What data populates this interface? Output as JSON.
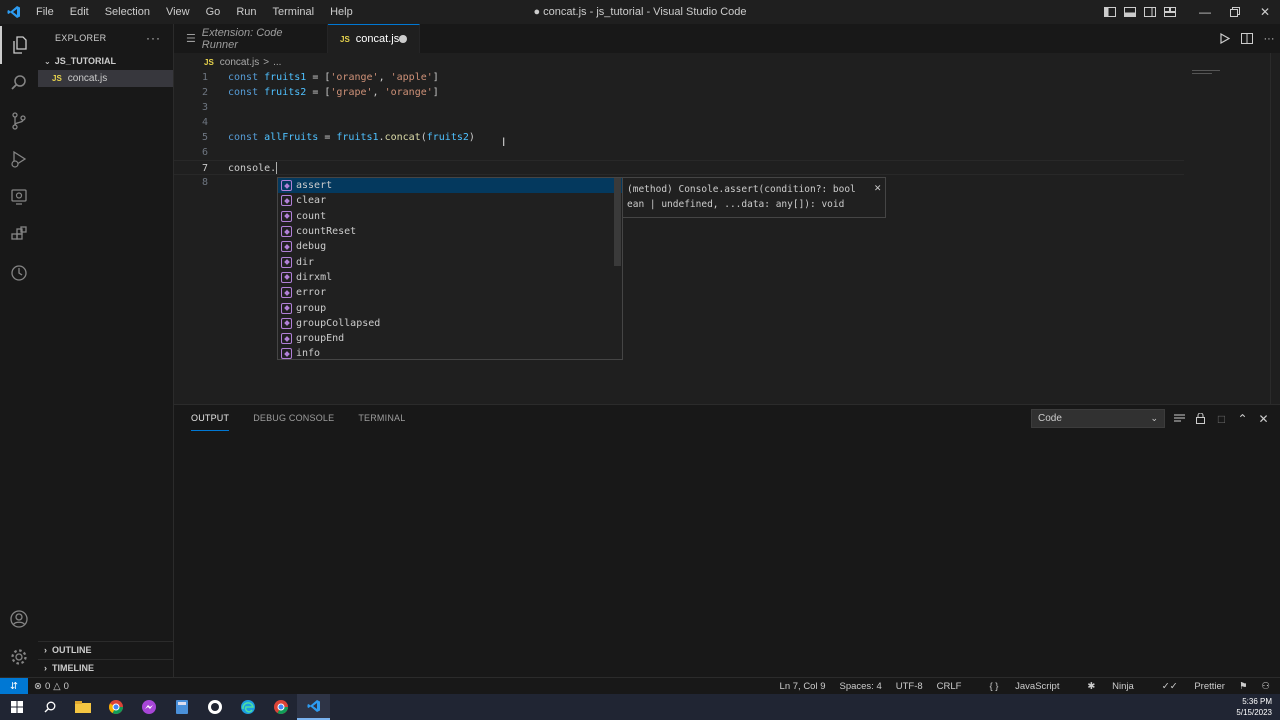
{
  "titlebar": {
    "menu": [
      "File",
      "Edit",
      "Selection",
      "View",
      "Go",
      "Run",
      "Terminal",
      "Help"
    ],
    "title": "● concat.js - js_tutorial - Visual Studio Code"
  },
  "sidebar": {
    "header": "EXPLORER",
    "folder": "JS_TUTORIAL",
    "file": "concat.js",
    "outline": "OUTLINE",
    "timeline": "TIMELINE"
  },
  "tabs": [
    {
      "label": "Extension: Code Runner",
      "active": false
    },
    {
      "label": "concat.js",
      "active": true,
      "badge": "JS"
    }
  ],
  "breadcrumb": {
    "file": "concat.js",
    "sep": ">",
    "rest": "..."
  },
  "code_lines": [
    {
      "num": "1"
    },
    {
      "num": "2"
    },
    {
      "num": "3"
    },
    {
      "num": "4"
    },
    {
      "num": "5"
    },
    {
      "num": "6"
    },
    {
      "num": "7"
    },
    {
      "num": "8"
    }
  ],
  "code": {
    "l1": {
      "kw": "const",
      "var": "fruits1",
      "eq": " = [",
      "s1": "'orange'",
      "comma": ", ",
      "s2": "'apple'",
      "end": "]"
    },
    "l2": {
      "kw": "const",
      "var": "fruits2",
      "eq": " = [",
      "s1": "'grape'",
      "comma": ", ",
      "s2": "'orange'",
      "end": "]"
    },
    "l5": {
      "kw": "const",
      "var": "allFruits",
      "eq": " = ",
      "obj": "fruits1",
      "dot": ".",
      "fn": "concat",
      "open": "(",
      "arg": "fruits2",
      "close": ")"
    },
    "l7": {
      "text": "console."
    }
  },
  "suggest": {
    "items": [
      "assert",
      "clear",
      "count",
      "countReset",
      "debug",
      "dir",
      "dirxml",
      "error",
      "group",
      "groupCollapsed",
      "groupEnd",
      "info"
    ],
    "selected_index": 0,
    "details": "(method) Console.assert(condition?: boolean | undefined, ...data: any[]): void",
    "details_line1": "(method) Console.assert(condition?: bool",
    "details_line2": "ean | undefined, ...data: any[]): void"
  },
  "panel": {
    "tabs": [
      "OUTPUT",
      "DEBUG CONSOLE",
      "TERMINAL"
    ],
    "active_tab": "OUTPUT",
    "channel": "Code"
  },
  "status": {
    "errors": "0",
    "warnings": "0",
    "position": "Ln 7, Col 9",
    "spaces": "Spaces: 4",
    "encoding": "UTF-8",
    "eol": "CRLF",
    "language": "JavaScript",
    "ninja": "Ninja",
    "prettier": "Prettier"
  },
  "taskbar": {
    "time": "5:36 PM",
    "date": "5/15/2023"
  },
  "colors": {
    "accent": "#0078d4",
    "keyword": "#569cd6",
    "variable": "#4fc1ff",
    "string": "#ce9178",
    "function": "#dcdcaa",
    "js_badge": "#e8d44d"
  }
}
